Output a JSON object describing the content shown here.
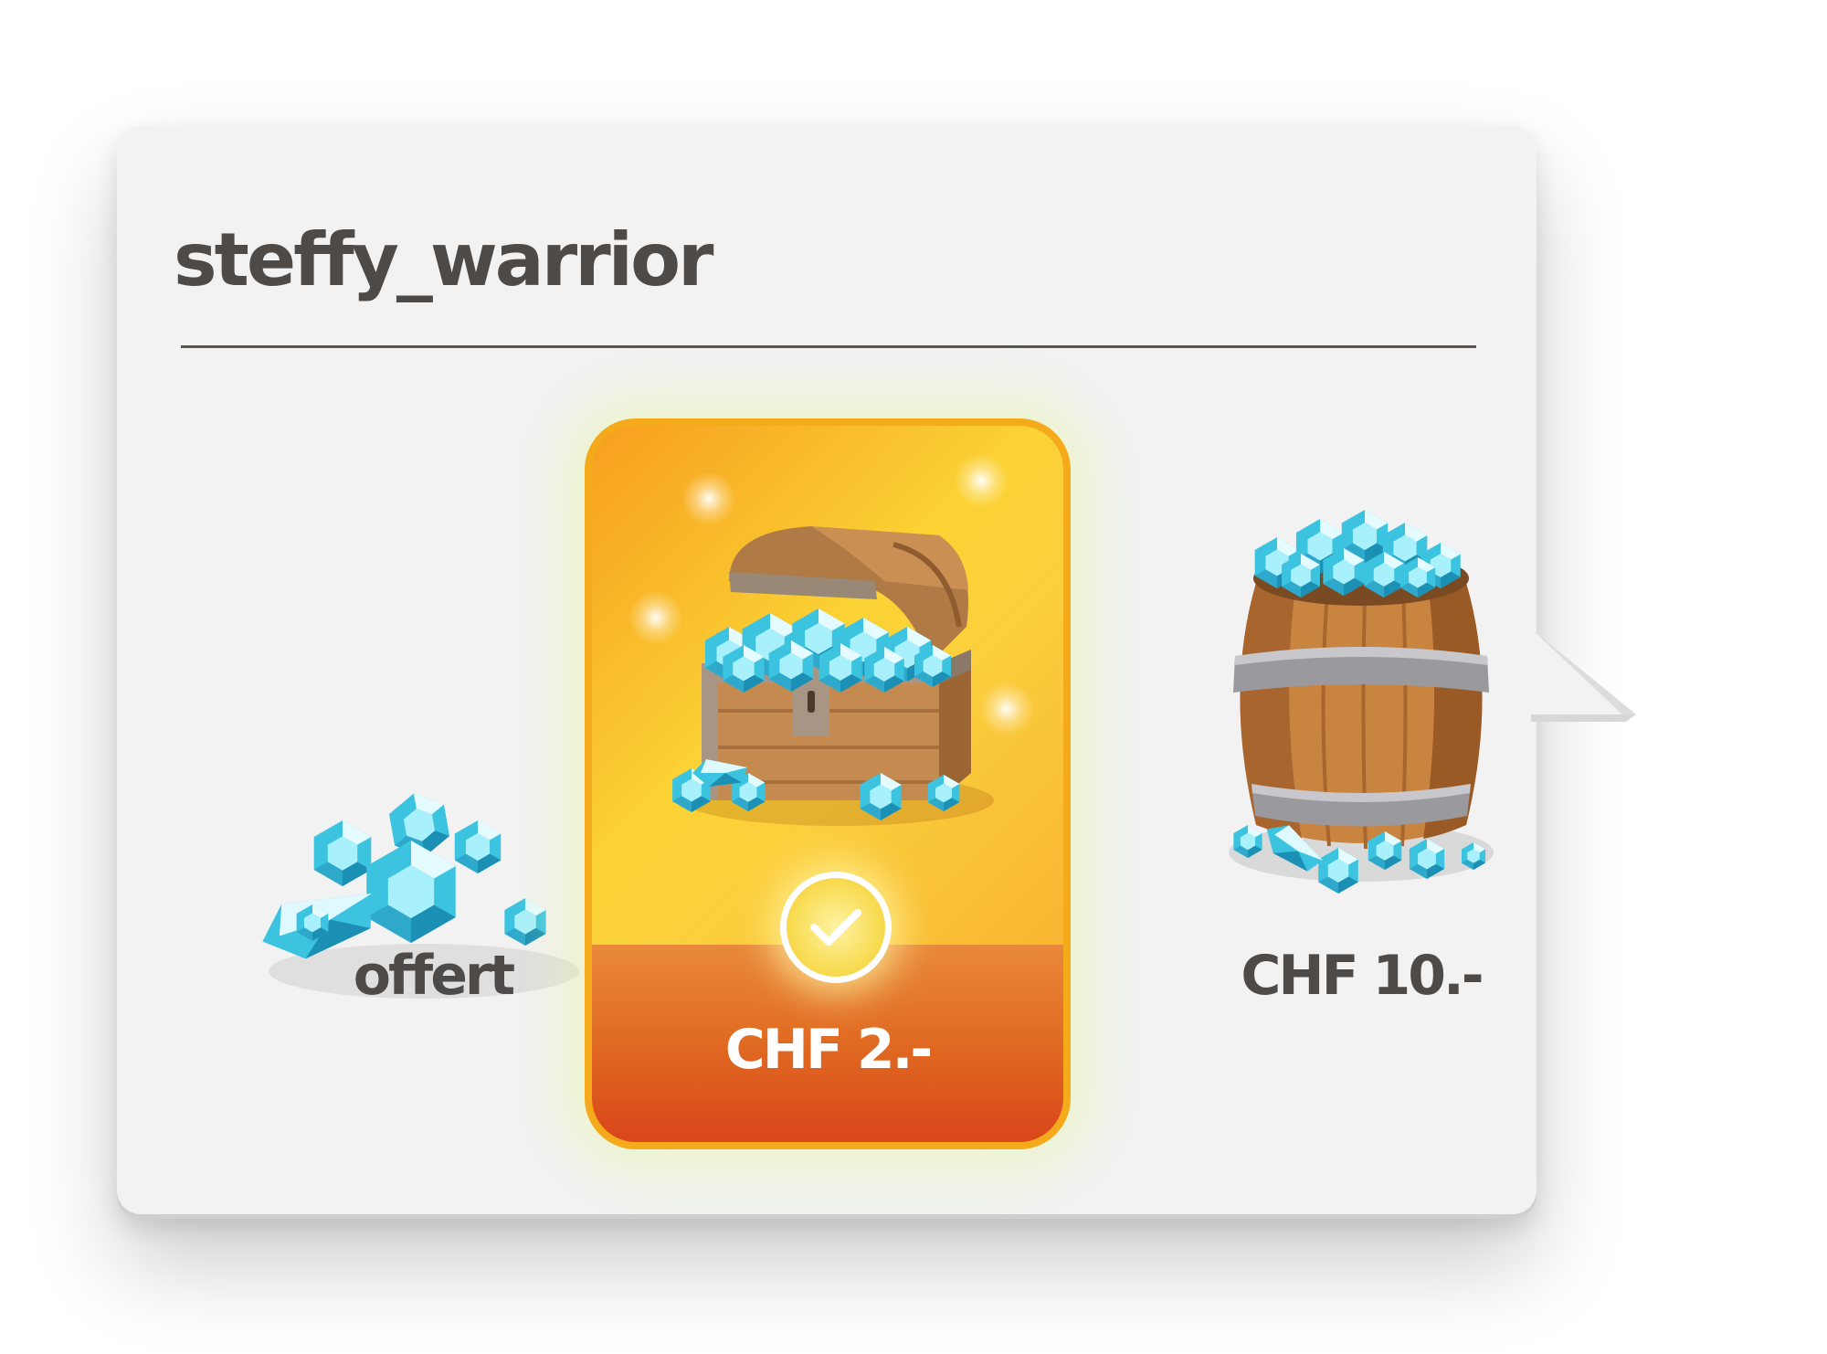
{
  "profile": {
    "username": "steffy_warrior"
  },
  "offers": [
    {
      "label": "offert",
      "icon": "gem-pile-icon",
      "selected": false
    },
    {
      "label": "CHF 2.-",
      "icon": "treasure-chest-icon",
      "selected": true
    },
    {
      "label": "CHF 10.-",
      "icon": "gem-barrel-icon",
      "selected": false
    }
  ],
  "colors": {
    "card": "#f2f2f2",
    "text": "#4e4a48",
    "selected_border": "#f4aa1a",
    "selected_bottom": "#e06a22",
    "gem": "#4fd3ea"
  }
}
